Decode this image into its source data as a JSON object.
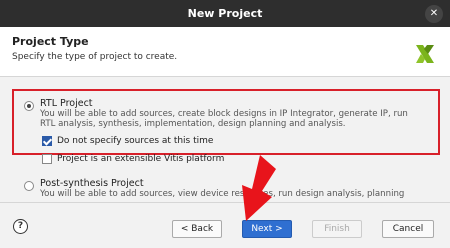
{
  "window": {
    "title": "New Project"
  },
  "header": {
    "title": "Project Type",
    "subtitle": "Specify the type of project to create."
  },
  "options": [
    {
      "title": "RTL Project",
      "selected": true,
      "desc_line1": "You will be able to add sources, create block designs in IP Integrator, generate IP, run",
      "desc_line2": "RTL analysis, synthesis, implementation, design planning and analysis."
    },
    {
      "title": "Post-synthesis Project",
      "selected": false,
      "desc_line1": "You will be able to add sources, view device resources, run design analysis, planning"
    }
  ],
  "checkboxes": [
    {
      "label": "Do not specify sources at this time",
      "checked": true
    },
    {
      "label": "Project is an extensible Vitis platform",
      "checked": false
    }
  ],
  "footer": {
    "help_label": "?",
    "back_label": "< Back",
    "next_label": "Next >",
    "finish_label": "Finish",
    "cancel_label": "Cancel"
  },
  "colors": {
    "highlight_border": "#d8202a",
    "primary_button": "#2f6fd1",
    "arrow": "#e8141b",
    "logo_green": "#7bb41c"
  }
}
